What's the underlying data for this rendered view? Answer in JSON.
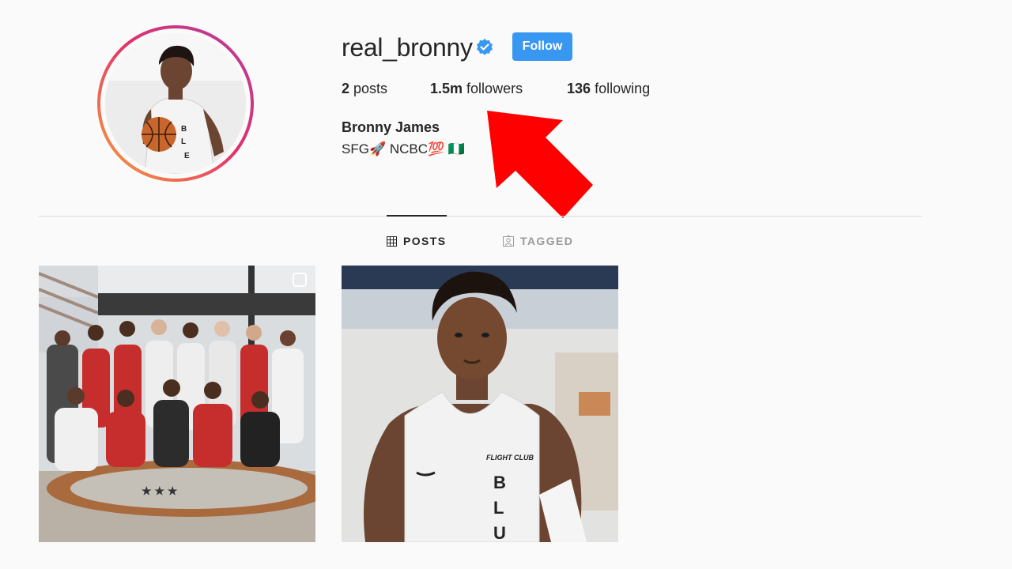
{
  "profile": {
    "username": "real_bronny",
    "verified_icon": "verified-badge-icon",
    "follow_label": "Follow",
    "stats": {
      "posts_count": "2",
      "posts_label": "posts",
      "followers_count": "1.5m",
      "followers_label": "followers",
      "following_count": "136",
      "following_label": "following"
    },
    "full_name": "Bronny James",
    "bio": "SFG🚀 NCBC💯 🇳🇬"
  },
  "tabs": [
    {
      "label": "POSTS",
      "icon": "grid-icon",
      "active": true
    },
    {
      "label": "TAGGED",
      "icon": "tagged-icon",
      "active": false
    }
  ],
  "posts": [
    {
      "name": "team-photo",
      "multi_image": true
    },
    {
      "name": "portrait-photo",
      "multi_image": false
    }
  ],
  "colors": {
    "accent": "#3897f0",
    "annotation_arrow": "#ff0000",
    "story_ring_start": "#f7a23a",
    "story_ring_end": "#b03fa0"
  }
}
